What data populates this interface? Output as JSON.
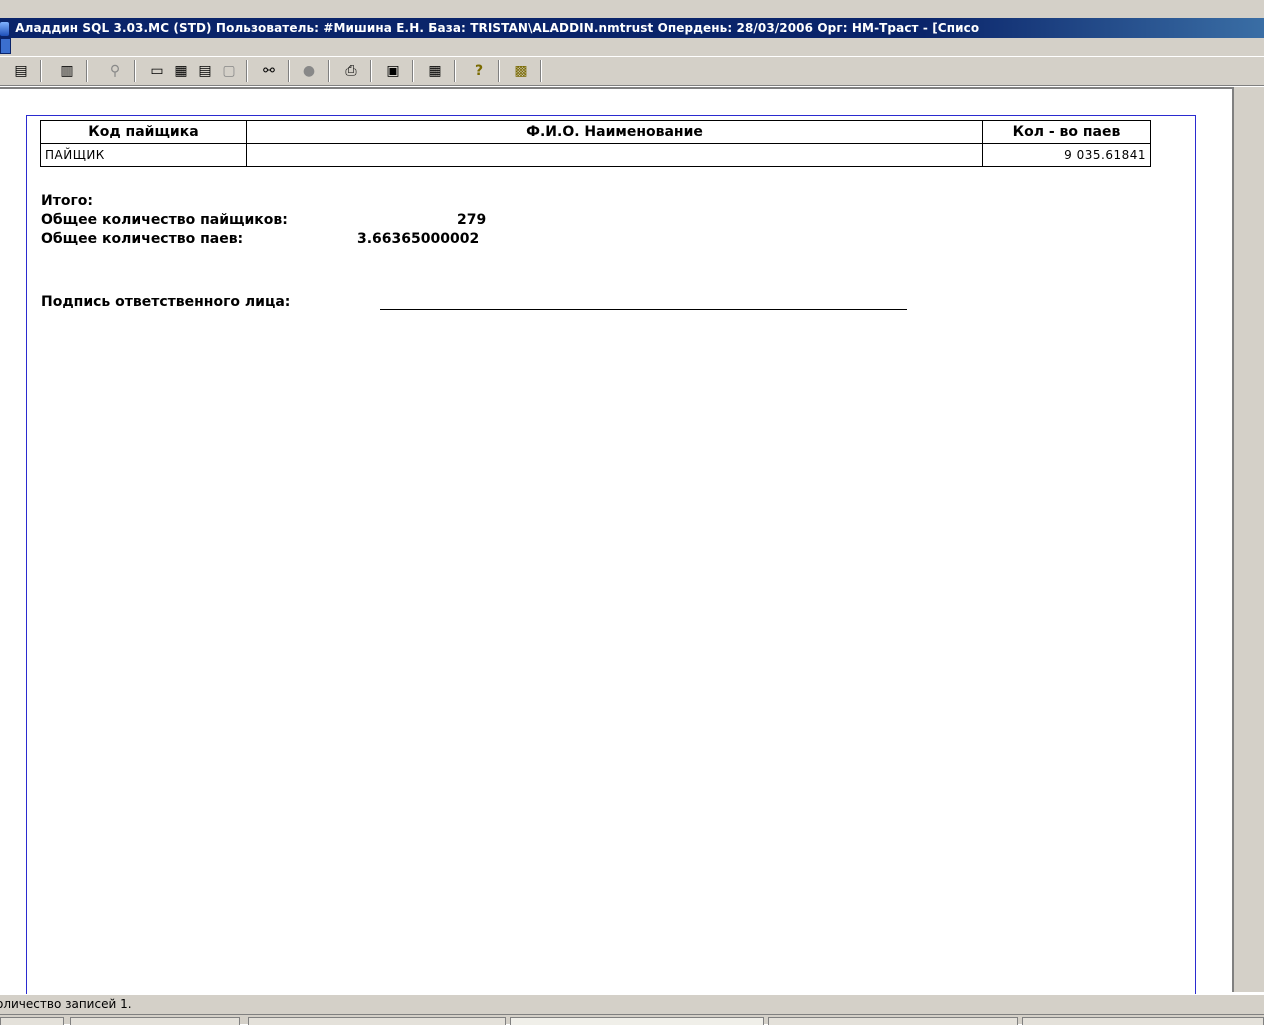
{
  "window": {
    "title_bold": "Аладдин SQL 3.03.MC (STD)",
    "title_rest": "Пользователь: #Мишина Е.Н. База: TRISTAN\\ALADDIN.nmtrust Опердень: 28/03/2006 Орг: НМ-Траст - [Списо"
  },
  "toolbar": {
    "buttons": [
      {
        "name": "properties-icon",
        "glyph": "▤"
      },
      {
        "name": "database-icon",
        "glyph": "▥"
      },
      {
        "name": "filter-icon",
        "glyph": "⚲"
      },
      {
        "name": "single-view-icon",
        "glyph": "▭"
      },
      {
        "name": "grid-view-icon",
        "glyph": "▦"
      },
      {
        "name": "tree-view-icon",
        "glyph": "▤"
      },
      {
        "name": "form-view-icon",
        "glyph": "▢"
      },
      {
        "name": "find-icon",
        "glyph": "⚯"
      },
      {
        "name": "stop-icon",
        "glyph": "●"
      },
      {
        "name": "print-icon",
        "glyph": "⎙"
      },
      {
        "name": "save-icon",
        "glyph": "▣"
      },
      {
        "name": "calendar-icon",
        "glyph": "▦"
      },
      {
        "name": "help-icon",
        "glyph": "?"
      },
      {
        "name": "exit-icon",
        "glyph": "▩"
      }
    ]
  },
  "report": {
    "headers": {
      "code": "Код пайщика",
      "name": "Ф.И.О. Наименование",
      "count": "Кол - во паев"
    },
    "rows": [
      {
        "code": "ПАЙЩИК",
        "name": "",
        "count": "9 035.61841"
      }
    ],
    "summary": {
      "total_label": "Итого:",
      "holders_label": "Общее количество пайщиков:",
      "holders_value": "279",
      "shares_label": "Общее количество паев:",
      "shares_value": "3.66365000002"
    },
    "signature_label": "Подпись ответственного лица:"
  },
  "status": {
    "records": "оличество записей 1."
  }
}
